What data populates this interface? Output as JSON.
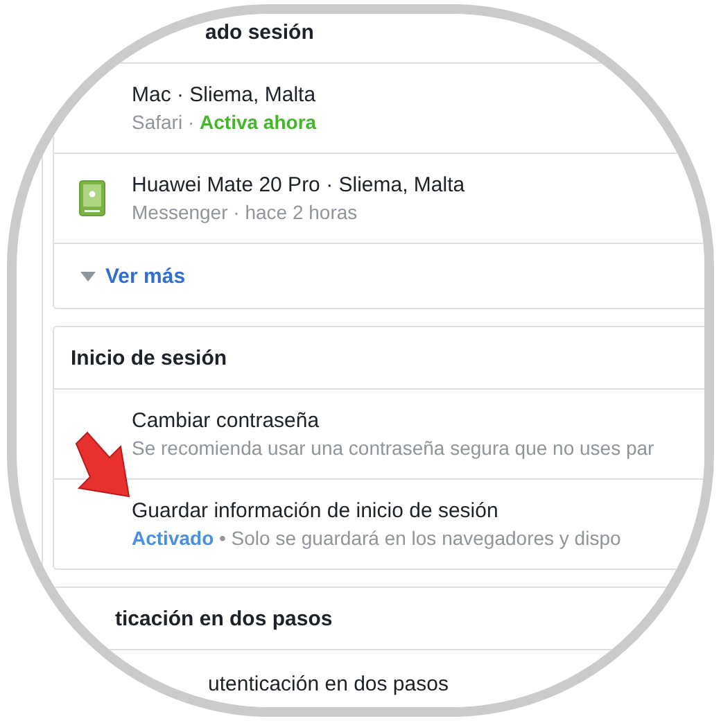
{
  "cards": [
    {
      "title": "ado sesión",
      "rows": [
        {
          "kind": "device",
          "title": "Mac · Sliema, Malta",
          "subtitle": [
            {
              "kind": "plain",
              "text": "Safari ·"
            },
            {
              "kind": "active",
              "text": "Activa ahora"
            }
          ]
        },
        {
          "kind": "phone-device",
          "title": "Huawei Mate 20 Pro · Sliema, Malta",
          "subtitle": [
            {
              "kind": "plain",
              "text": "Messenger · hace 2 horas"
            }
          ]
        },
        {
          "kind": "more",
          "title": "Ver más"
        }
      ]
    },
    {
      "title": "Inicio de sesión",
      "rows": [
        {
          "kind": "setting",
          "title": "Cambiar contraseña",
          "subtitle": [
            {
              "kind": "plain",
              "text": "Se recomienda usar una contraseña segura que no uses par"
            }
          ]
        },
        {
          "kind": "setting",
          "title": "Guardar información de inicio de sesión",
          "subtitle": [
            {
              "kind": "enabled",
              "text": "Activado"
            },
            {
              "kind": "plain",
              "text": "• Solo se guardará en los navegadores y dispo"
            }
          ]
        }
      ]
    },
    {
      "title": "ticación en dos pasos",
      "rows": [
        {
          "kind": "setting",
          "title": "utenticación en dos pasos"
        }
      ]
    }
  ]
}
